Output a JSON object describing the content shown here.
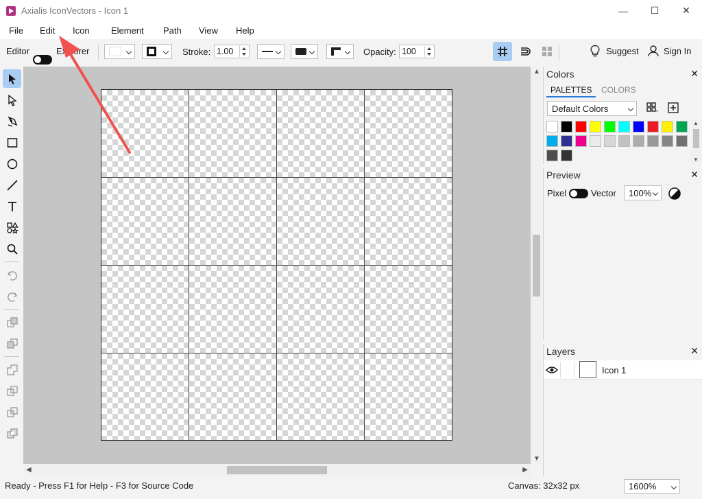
{
  "window": {
    "title": "Axialis IconVectors - Icon 1",
    "minimize": "—",
    "maximize": "☐",
    "close": "✕"
  },
  "menu": {
    "items": [
      "File",
      "Edit",
      "Icon",
      "Element",
      "Path",
      "View",
      "Help"
    ]
  },
  "toolbar": {
    "editor_label": "Editor",
    "explorer_label": "Explorer",
    "stroke_label": "Stroke:",
    "stroke_value": "1.00",
    "opacity_label": "Opacity:",
    "opacity_value": "100",
    "suggest_label": "Suggest",
    "signin_label": "Sign In"
  },
  "tools": [
    {
      "name": "select-tool",
      "active": true
    },
    {
      "name": "direct-select-tool"
    },
    {
      "name": "pen-tool"
    },
    {
      "name": "rectangle-tool"
    },
    {
      "name": "ellipse-tool"
    },
    {
      "name": "line-tool"
    },
    {
      "name": "text-tool"
    },
    {
      "name": "shapes-tool"
    },
    {
      "name": "zoom-tool"
    },
    {
      "name": "undo-tool"
    },
    {
      "name": "redo-tool"
    },
    {
      "name": "arrange-front-tool"
    },
    {
      "name": "arrange-back-tool"
    },
    {
      "name": "boolean-union-tool"
    },
    {
      "name": "boolean-subtract-tool"
    },
    {
      "name": "boolean-intersect-tool"
    },
    {
      "name": "boolean-exclude-tool"
    }
  ],
  "colors_panel": {
    "title": "Colors",
    "tab_palettes": "PALETTES",
    "tab_colors": "COLORS",
    "palette_select": "Default Colors",
    "swatches": [
      "#ffffff",
      "#000000",
      "#ff0000",
      "#ffff00",
      "#00ff00",
      "#00ffff",
      "#0000ff",
      "#ed1c24",
      "#fff200",
      "#00a651",
      "#00aeef",
      "#2e3192",
      "#ec008c",
      "#ebebeb",
      "#d6d6d6",
      "#c2c2c2",
      "#adadad",
      "#999999",
      "#858585",
      "#707070",
      "#4d4d4d",
      "#333333"
    ]
  },
  "preview_panel": {
    "title": "Preview",
    "pixel_label": "Pixel",
    "vector_label": "Vector",
    "zoom_value": "100%"
  },
  "layers_panel": {
    "title": "Layers",
    "layers": [
      {
        "name": "Icon 1"
      }
    ]
  },
  "status": {
    "ready": "Ready - Press F1 for Help - F3 for Source Code",
    "canvas": "Canvas: 32x32 px",
    "zoom": "1600%"
  },
  "colors": {
    "accent": "#a9ccf3",
    "annotation": "#f0524f",
    "brand": "#b0317e"
  }
}
